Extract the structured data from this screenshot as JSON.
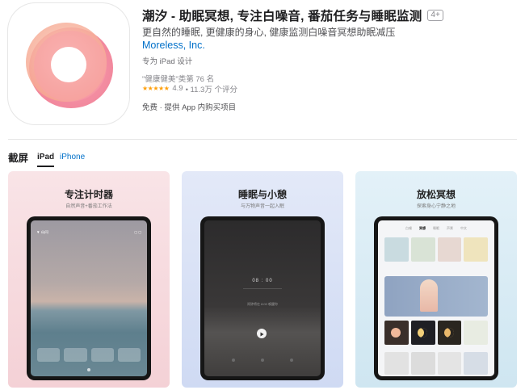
{
  "app": {
    "title": "潮汐 - 助眠冥想, 专注白噪音, 番茄任务与睡眠监测",
    "age_rating": "4+",
    "subtitle": "更自然的睡眠, 更健康的身心, 健康监测白噪音冥想助眠减压",
    "developer": "Moreless, Inc.",
    "designed_for": "专为 iPad 设计",
    "ranking": "\"健康健美\"类第 76 名",
    "rating": "4.9",
    "rating_count": "• 11.3万 个评分",
    "price": "免费 · 提供 App 内购买项目",
    "stars": "★★★★★",
    "colors": {
      "accent": "#0070c9",
      "star": "#ff9f0a",
      "icon_ring": "#f47a8a"
    },
    "icon": "tide-ring-icon"
  },
  "screenshots_section": {
    "title": "截屏",
    "tabs": [
      {
        "label": "iPad",
        "active": true
      },
      {
        "label": "iPhone",
        "active": false
      }
    ]
  },
  "screenshots": [
    {
      "title": "专注计时器",
      "caption": "自然声音+番茄工作法",
      "screen": {
        "top_left": "▼ 山间",
        "top_right": "◻ ◻"
      }
    },
    {
      "title": "睡眠与小憩",
      "caption": "与万物声音一起入眠",
      "screen": {
        "time": "08 : 00",
        "sub": "闹钟将在 8:00 唤醒你"
      }
    },
    {
      "title": "放松冥想",
      "caption": "探索身心宁静之地",
      "screen": {
        "tabs": [
          "白噪",
          "冥想",
          "睡眠",
          "声景",
          "中文"
        ]
      }
    }
  ]
}
